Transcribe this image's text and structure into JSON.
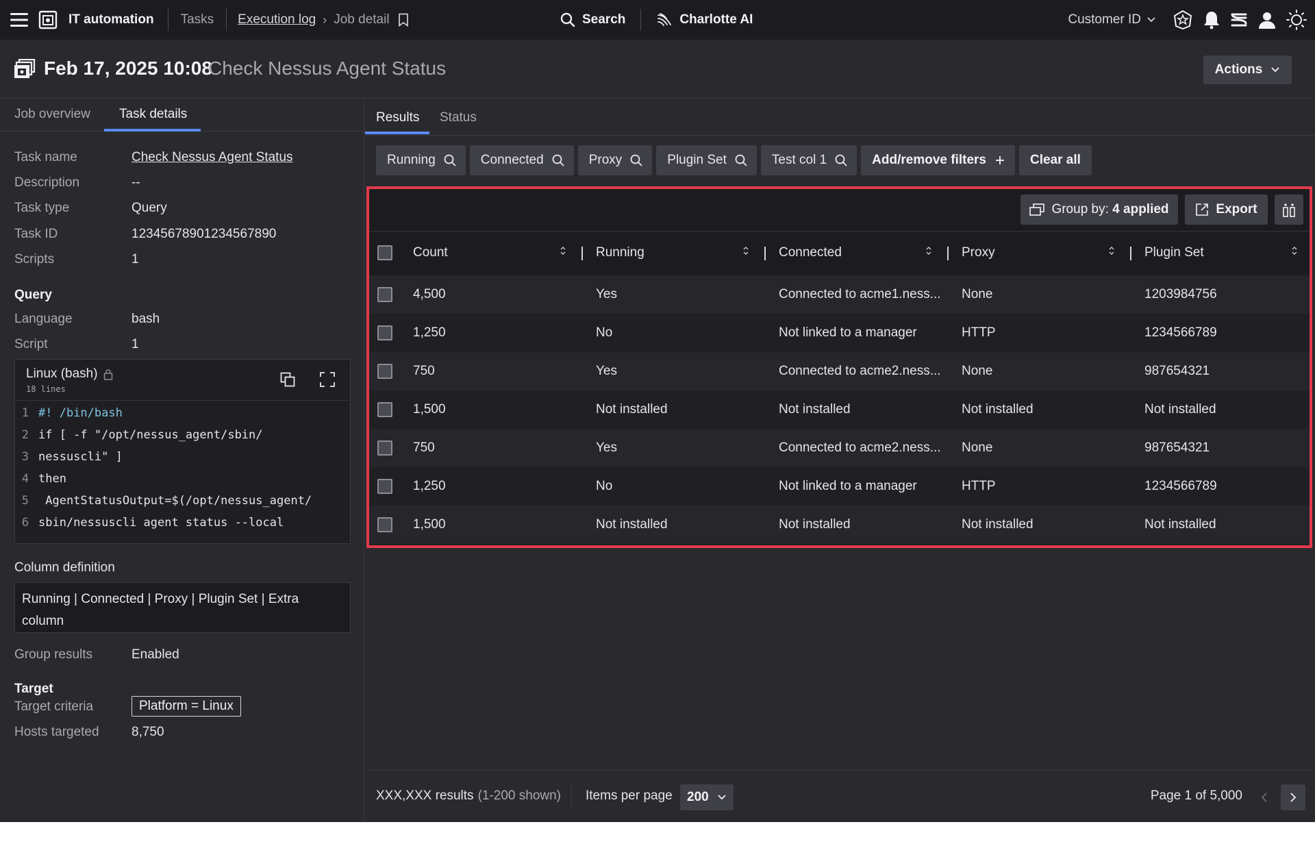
{
  "nav": {
    "app_title": "IT automation",
    "crumb_tasks": "Tasks",
    "crumb_execution_log": "Execution log",
    "crumb_current": "Job detail",
    "search_label": "Search",
    "ai_label": "Charlotte AI",
    "customer_id_label": "Customer ID",
    "icons": [
      "menu-icon",
      "app-logo-icon",
      "bookmark-icon",
      "search-icon",
      "charlotte-ai-icon",
      "chevron-down-icon",
      "shield-badge-icon",
      "bell-icon",
      "stacks-icon",
      "user-icon",
      "sun-icon"
    ]
  },
  "header": {
    "date": "Feb 17, 2025 10:08",
    "job_name": "Check Nessus Agent Status",
    "actions_label": "Actions"
  },
  "left": {
    "tabs": [
      {
        "label": "Job overview",
        "active": false
      },
      {
        "label": "Task details",
        "active": true
      }
    ],
    "task_name_label": "Task name",
    "task_name": "Check Nessus Agent Status",
    "description_label": "Description",
    "description": "--",
    "task_type_label": "Task type",
    "task_type": "Query",
    "task_id_label": "Task ID",
    "task_id": "12345678901234567890",
    "scripts_label": "Scripts",
    "scripts": "1",
    "query_title": "Query",
    "language_label": "Language",
    "language": "bash",
    "script_label": "Script",
    "script": "1",
    "code": {
      "title": "Linux (bash)",
      "line_count": "18 lines",
      "lines": [
        {
          "num": "1",
          "text": "#! /bin/bash"
        },
        {
          "num": "2",
          "text": "if [ -f \"/opt/nessus_agent/sbin/"
        },
        {
          "num": "3",
          "text": "nessuscli\" ]"
        },
        {
          "num": "4",
          "text": "then"
        },
        {
          "num": "5",
          "text": " AgentStatusOutput=$(/opt/nessus_agent/"
        },
        {
          "num": "6",
          "text": "sbin/nessuscli agent status --local"
        }
      ]
    },
    "column_definition_title": "Column definition",
    "column_definition": "Running |  Connected | Proxy | Plugin Set | Extra column",
    "group_results_label": "Group results",
    "group_results": "Enabled",
    "target_title": "Target",
    "target_criteria_label": "Target criteria",
    "target_criteria": "Platform = Linux",
    "hosts_targeted_label": "Hosts targeted",
    "hosts_targeted": "8,750"
  },
  "right": {
    "tabs": [
      {
        "label": "Results",
        "active": true
      },
      {
        "label": "Status",
        "active": false
      }
    ],
    "filters": [
      "Running",
      "Connected",
      "Proxy",
      "Plugin Set",
      "Test col 1"
    ],
    "add_filters_label": "Add/remove filters",
    "clear_all_label": "Clear all",
    "group_by_prefix": "Group by:",
    "group_by_value": "4 applied",
    "export_label": "Export",
    "columns": [
      "Count",
      "Running",
      "Connected",
      "Proxy",
      "Plugin Set"
    ],
    "rows": [
      [
        "4,500",
        "Yes",
        "Connected to acme1.ness...",
        "None",
        "1203984756"
      ],
      [
        "1,250",
        "No",
        "Not linked to a manager",
        "HTTP",
        "1234566789"
      ],
      [
        "750",
        "Yes",
        "Connected to acme2.ness...",
        "None",
        "987654321"
      ],
      [
        "1,500",
        "Not installed",
        "Not installed",
        "Not installed",
        "Not installed"
      ],
      [
        "750",
        "Yes",
        "Connected to acme2.ness...",
        "None",
        "987654321"
      ],
      [
        "1,250",
        "No",
        "Not linked to a manager",
        "HTTP",
        "1234566789"
      ],
      [
        "1,500",
        "Not installed",
        "Not installed",
        "Not installed",
        "Not installed"
      ]
    ],
    "results_count": "XXX,XXX results",
    "results_shown": "(1-200 shown)",
    "items_per_page_label": "Items per page",
    "items_per_page": "200",
    "page_label": "Page 1 of 5,000"
  },
  "colors": {
    "accent": "#5b8bf5",
    "highlight_border": "#e3394c",
    "background": "#29292e",
    "nav_background": "#1c1c20"
  }
}
